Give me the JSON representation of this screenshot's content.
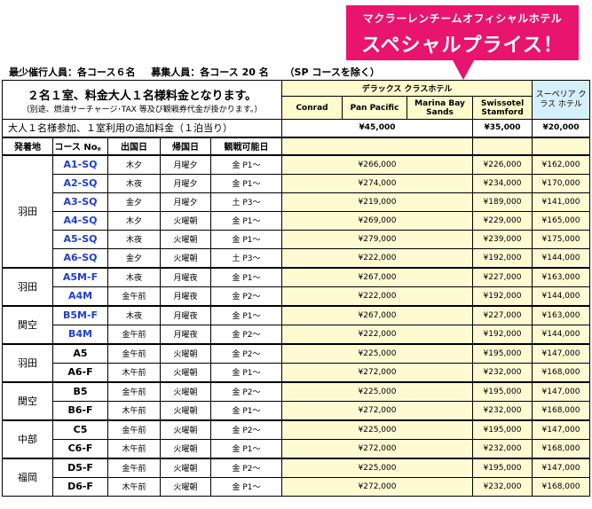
{
  "banner": {
    "line1": "マクラーレンチームオフィシャルホテル",
    "line2": "スペシャルプライス！"
  },
  "info": {
    "min_participants": "最少催行人員：各コース６名",
    "recruit": "募集人員：各コース 20 名",
    "recruit_note": "（SP コースを除く）"
  },
  "notice": {
    "main": "２名１室、料金大人１名様料金となります。",
    "sub": "（別途、燃油サーチャージ･TAX 等及び観戦券代金が掛かります。）",
    "single_supplement_label": "大人１名様参加、１室利用の追加料金（１泊当り）"
  },
  "hotel_groups": {
    "deluxe": "デラックス クラスホテル",
    "superior": "スーペリア クラス ホテル"
  },
  "hotels": {
    "conrad": "Conrad",
    "pan_pacific": "Pan Pacific",
    "marina_bay_sands": "Marina Bay Sands",
    "swissotel": "Swissotel Stamford"
  },
  "supplements": {
    "deluxe": "¥45,000",
    "swissotel": "¥35,000",
    "superior": "¥20,000"
  },
  "columns": {
    "origin": "発着地",
    "course": "コース No。",
    "depart": "出国日",
    "return": "帰国日",
    "watch": "観戦可能日"
  },
  "groups": [
    {
      "origin": "羽田",
      "rows": [
        {
          "code": "A1-SQ",
          "blue": true,
          "depart": "木夕",
          "return": "月曜夕",
          "watch": "金 P1～",
          "deluxe": "¥266,000",
          "swiss": "¥226,000",
          "superior": "¥162,000"
        },
        {
          "code": "A2-SQ",
          "blue": true,
          "depart": "木夜",
          "return": "月曜夕",
          "watch": "金 P1～",
          "deluxe": "¥274,000",
          "swiss": "¥234,000",
          "superior": "¥170,000"
        },
        {
          "code": "A3-SQ",
          "blue": true,
          "depart": "金夕",
          "return": "月曜夕",
          "watch": "土 P3～",
          "deluxe": "¥219,000",
          "swiss": "¥189,000",
          "superior": "¥141,000"
        },
        {
          "code": "A4-SQ",
          "blue": true,
          "depart": "木夕",
          "return": "火曜朝",
          "watch": "金 P1～",
          "deluxe": "¥269,000",
          "swiss": "¥229,000",
          "superior": "¥165,000"
        },
        {
          "code": "A5-SQ",
          "blue": true,
          "depart": "木夜",
          "return": "火曜朝",
          "watch": "金 P1～",
          "deluxe": "¥279,000",
          "swiss": "¥239,000",
          "superior": "¥175,000"
        },
        {
          "code": "A6-SQ",
          "blue": true,
          "depart": "金夕",
          "return": "火曜朝",
          "watch": "土 P3～",
          "deluxe": "¥222,000",
          "swiss": "¥192,000",
          "superior": "¥144,000"
        }
      ]
    },
    {
      "origin": "羽田",
      "rows": [
        {
          "code": "A5M-F",
          "blue": true,
          "depart": "木夜",
          "return": "月曜夜",
          "watch": "金 P1～",
          "deluxe": "¥267,000",
          "swiss": "¥227,000",
          "superior": "¥163,000"
        },
        {
          "code": "A4M",
          "blue": true,
          "depart": "金午前",
          "return": "月曜夜",
          "watch": "金 P2～",
          "deluxe": "¥222,000",
          "swiss": "¥192,000",
          "superior": "¥144,000"
        }
      ]
    },
    {
      "origin": "関空",
      "rows": [
        {
          "code": "B5M-F",
          "blue": true,
          "depart": "木夜",
          "return": "月曜夜",
          "watch": "金 P1～",
          "deluxe": "¥267,000",
          "swiss": "¥227,000",
          "superior": "¥163,000"
        },
        {
          "code": "B4M",
          "blue": true,
          "depart": "金午前",
          "return": "月曜夜",
          "watch": "金 P2～",
          "deluxe": "¥222,000",
          "swiss": "¥192,000",
          "superior": "¥144,000"
        }
      ]
    },
    {
      "origin": "羽田",
      "rows": [
        {
          "code": "A5",
          "blue": false,
          "depart": "金午前",
          "return": "火曜朝",
          "watch": "金 P2～",
          "deluxe": "¥225,000",
          "swiss": "¥195,000",
          "superior": "¥147,000"
        },
        {
          "code": "A6-F",
          "blue": false,
          "depart": "木午前",
          "return": "火曜朝",
          "watch": "金 P1～",
          "deluxe": "¥272,000",
          "swiss": "¥232,000",
          "superior": "¥168,000"
        }
      ]
    },
    {
      "origin": "関空",
      "rows": [
        {
          "code": "B5",
          "blue": false,
          "depart": "金午前",
          "return": "火曜朝",
          "watch": "金 P2～",
          "deluxe": "¥225,000",
          "swiss": "¥195,000",
          "superior": "¥147,000"
        },
        {
          "code": "B6-F",
          "blue": false,
          "depart": "木午前",
          "return": "火曜朝",
          "watch": "金 P1～",
          "deluxe": "¥272,000",
          "swiss": "¥232,000",
          "superior": "¥168,000"
        }
      ]
    },
    {
      "origin": "中部",
      "rows": [
        {
          "code": "C5",
          "blue": false,
          "depart": "金午前",
          "return": "火曜朝",
          "watch": "金 P2～",
          "deluxe": "¥225,000",
          "swiss": "¥195,000",
          "superior": "¥147,000"
        },
        {
          "code": "C6-F",
          "blue": false,
          "depart": "木午前",
          "return": "火曜朝",
          "watch": "金 P1～",
          "deluxe": "¥272,000",
          "swiss": "¥232,000",
          "superior": "¥168,000"
        }
      ]
    },
    {
      "origin": "福岡",
      "rows": [
        {
          "code": "D5-F",
          "blue": false,
          "depart": "金午前",
          "return": "火曜朝",
          "watch": "金 P2～",
          "deluxe": "¥225,000",
          "swiss": "¥195,000",
          "superior": "¥147,000"
        },
        {
          "code": "D6-F",
          "blue": false,
          "depart": "木午前",
          "return": "火曜朝",
          "watch": "金 P1～",
          "deluxe": "¥272,000",
          "swiss": "¥232,000",
          "superior": "¥168,000"
        }
      ]
    }
  ]
}
